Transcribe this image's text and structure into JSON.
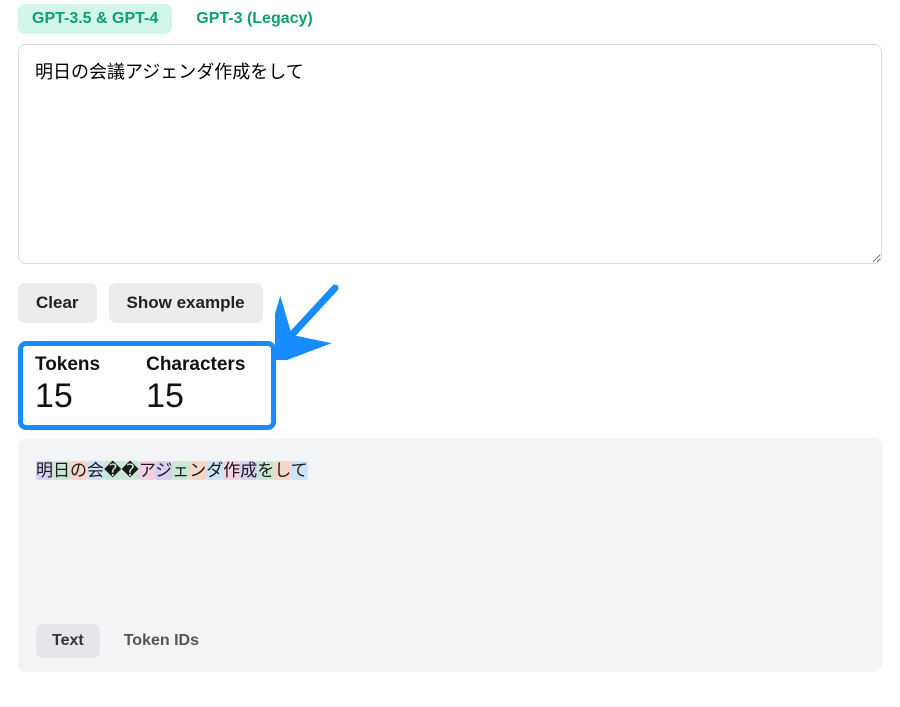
{
  "tabs": {
    "active": "GPT-3.5 & GPT-4",
    "legacy": "GPT-3 (Legacy)"
  },
  "input": {
    "value": "明日の会議アジェンダ作成をして"
  },
  "buttons": {
    "clear": "Clear",
    "show_example": "Show example"
  },
  "metrics": {
    "tokens_label": "Tokens",
    "tokens_value": "15",
    "characters_label": "Characters",
    "characters_value": "15"
  },
  "tokenized": {
    "segments": [
      {
        "text": "明",
        "c": "c0"
      },
      {
        "text": "日",
        "c": "c1"
      },
      {
        "text": "の",
        "c": "c2"
      },
      {
        "text": "会",
        "c": "c3"
      },
      {
        "text": "��",
        "c": "c1"
      },
      {
        "text": "ア",
        "c": "c4"
      },
      {
        "text": "ジ",
        "c": "c0"
      },
      {
        "text": "ェ",
        "c": "c1"
      },
      {
        "text": "ン",
        "c": "c2"
      },
      {
        "text": "ダ",
        "c": "c3"
      },
      {
        "text": "作",
        "c": "c4"
      },
      {
        "text": "成",
        "c": "c0"
      },
      {
        "text": "を",
        "c": "c1"
      },
      {
        "text": "し",
        "c": "c2"
      },
      {
        "text": "て",
        "c": "c3"
      }
    ]
  },
  "view_tabs": {
    "text": "Text",
    "token_ids": "Token IDs"
  },
  "annotation": {
    "arrow_color": "#168cff"
  }
}
